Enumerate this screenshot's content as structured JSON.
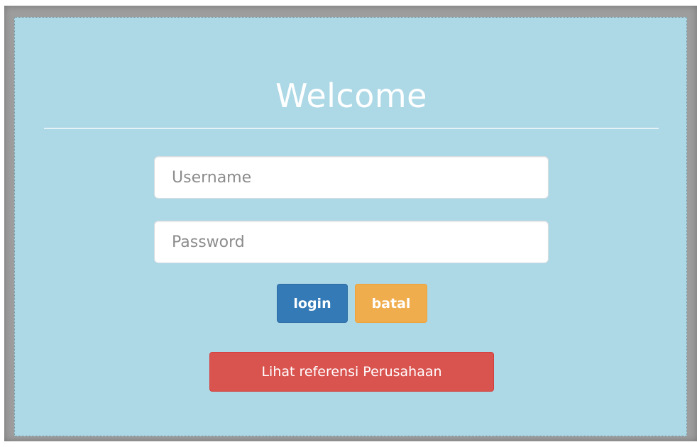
{
  "login_form": {
    "title": "Welcome",
    "username_placeholder": "Username",
    "password_placeholder": "Password",
    "login_label": "login",
    "cancel_label": "batal",
    "reference_label": "Lihat referensi Perusahaan"
  },
  "colors": {
    "panel_background": "#add8e6",
    "login_button": "#337ab7",
    "cancel_button": "#f0ad4e",
    "reference_button": "#d9534f"
  }
}
